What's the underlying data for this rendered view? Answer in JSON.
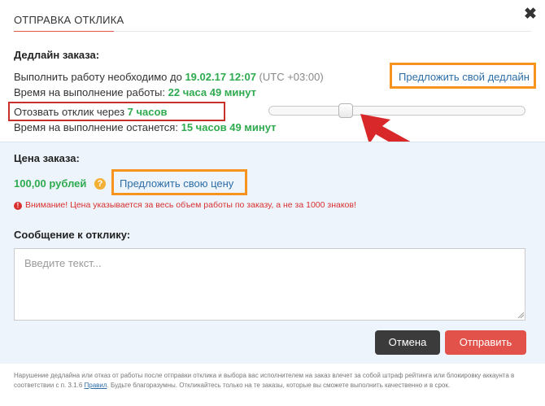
{
  "header": {
    "title": "ОТПРАВКА ОТКЛИКА",
    "close_label": "✖"
  },
  "deadline": {
    "section_title": "Дедлайн заказа:",
    "complete_prefix": "Выполнить работу необходимо до",
    "complete_date": "19.02.17 12:07",
    "timezone": "(UTC +03:00)",
    "work_time_prefix": "Время на выполнение работы:",
    "work_time_value": "22 часа 49 минут",
    "propose_link": "Предложить свой дедлайн",
    "recall_prefix": "Отозвать отклик через",
    "recall_value": "7 часов",
    "remaining_prefix": "Время на выполнение останется:",
    "remaining_value": "15 часов 49 минут",
    "slider_fraction": 0.31
  },
  "price": {
    "section_title": "Цена заказа:",
    "value": "100,00 рублей",
    "help_label": "?",
    "propose_link": "Предложить свою цену",
    "warning_icon": "!",
    "warning": "Внимание! Цена указывается за весь объем работы по заказу, а не за 1000 знаков!"
  },
  "message": {
    "section_title": "Сообщение к отклику:",
    "placeholder": "Введите текст..."
  },
  "buttons": {
    "cancel": "Отмена",
    "send": "Отправить"
  },
  "footer": {
    "text_before": "Нарушение дедлайна или отказ от работы после отправки отклика и выбора вас исполнителем на заказ влечет за собой штраф рейтинга или блокировку аккаунта в соответствии с п. 3.1.6",
    "rules_link": "Правил",
    "text_after": ". Будьте благоразумны. Откликайтесь только на те заказы, которые вы сможете выполнить качественно и в срок."
  },
  "colors": {
    "accent_orange": "#f7931e",
    "highlight_red": "#c9302c",
    "green": "#2eab4f",
    "send_button": "#e2514a",
    "cancel_button": "#3b3b3b",
    "section_bg": "#eef4fb"
  }
}
